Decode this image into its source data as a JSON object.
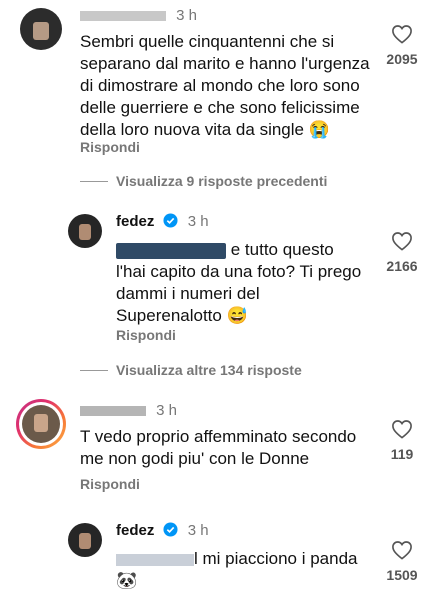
{
  "comments": [
    {
      "time": "3 h",
      "text_lines": [
        "Sembri quelle cinquantenni che si",
        "separano dal marito e hanno l'urgenza",
        "di dimostrare al mondo che loro sono",
        "delle guerriere e che sono felicissime",
        "della loro nuova vita da single 😭"
      ],
      "reply_label": "Rispondi",
      "likes": "2095"
    },
    {
      "username": "fedez",
      "time": "3 h",
      "text_first": "e tutto questo",
      "text_lines": [
        "l'hai capito da una foto? Ti prego",
        "dammi i numeri del",
        "Superenalotto 😅"
      ],
      "reply_label": "Rispondi",
      "likes": "2166"
    },
    {
      "time": "3 h",
      "text_lines": [
        "T vedo proprio affemminato secondo",
        "me non godi piu' con le Donne"
      ],
      "reply_label": "Rispondi",
      "likes": "119"
    },
    {
      "username": "fedez",
      "time": "3 h",
      "text_after_mention": "l mi piacciono i panda",
      "emoji": "🐼",
      "likes": "1509"
    }
  ],
  "threads": [
    {
      "label": "Visualizza 9 risposte precedenti"
    },
    {
      "label": "Visualizza altre 134 risposte"
    }
  ],
  "colors": {
    "verified": "#0095f6",
    "muted": "#777777",
    "redaction": "#1f3a52"
  }
}
